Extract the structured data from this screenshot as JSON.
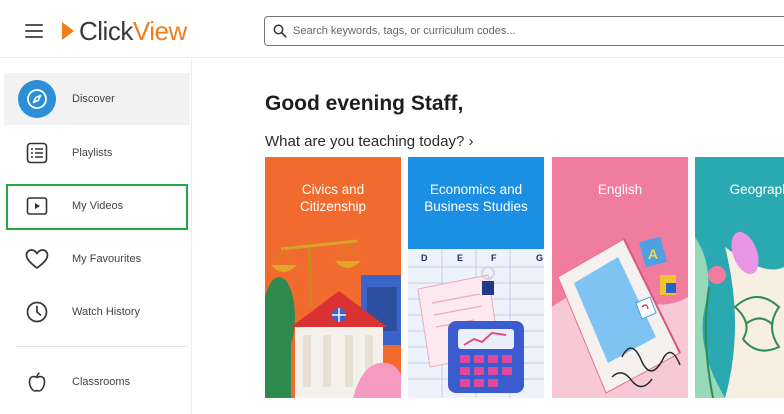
{
  "header": {
    "logo_click": "Click",
    "logo_view": "View",
    "search_placeholder": "Search keywords, tags, or curriculum codes..."
  },
  "sidebar": {
    "items": [
      {
        "label": "Discover",
        "icon": "compass-icon",
        "active": true
      },
      {
        "label": "Playlists",
        "icon": "list-icon"
      },
      {
        "label": "My Videos",
        "icon": "play-icon"
      },
      {
        "label": "My Favourites",
        "icon": "heart-icon"
      },
      {
        "label": "Watch History",
        "icon": "clock-icon"
      },
      {
        "label": "Classrooms",
        "icon": "apple-icon"
      }
    ]
  },
  "main": {
    "greeting": "Good evening Staff,",
    "subheading": "What are you teaching today? ›",
    "cards": [
      {
        "title": "Civics and Citizenship",
        "color": "#f26b2e"
      },
      {
        "title": "Economics and Business Studies",
        "color": "#1a8fe3"
      },
      {
        "title": "English",
        "color": "#f07ca0"
      },
      {
        "title": "Geography",
        "color": "#2aaab0"
      }
    ]
  },
  "colors": {
    "brand_orange": "#f07f1a",
    "active_icon_bg": "#2c8fd8",
    "highlight_box": "#22a845"
  }
}
